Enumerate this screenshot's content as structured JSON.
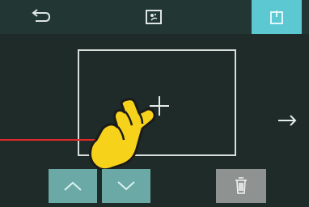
{
  "screen": {
    "icons": {
      "back": "back-arrow-icon",
      "mode": "zone-mode-icon",
      "power": "power-icon",
      "zone": "crosshair-icon",
      "next": "right-arrow-icon",
      "pointer": "tap-hand-icon",
      "up": "chevron-up-icon",
      "down": "chevron-down-icon",
      "delete": "trash-icon"
    },
    "colors": {
      "background": "#1f2b28",
      "topbar": "#223634",
      "power_button": "#5bc8d2",
      "nav_buttons": "#6aa9a5",
      "delete_button": "#8e9391",
      "pointer_line": "#e02a2a",
      "hand": "#f7d21a"
    }
  }
}
